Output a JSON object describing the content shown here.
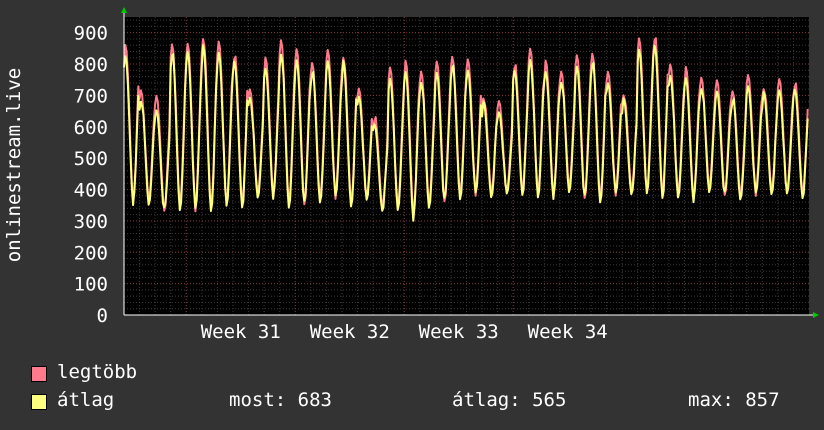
{
  "chart_data": {
    "type": "line",
    "ylabel": "onlinestream.live",
    "ylim": [
      0,
      950
    ],
    "y_ticks": [
      0,
      100,
      200,
      300,
      400,
      500,
      600,
      700,
      800,
      900
    ],
    "x_ticks": [
      "Week 31",
      "Week 32",
      "Week 33",
      "Week 34"
    ],
    "grid": true,
    "legend_placement": "bottom-left",
    "days": 44,
    "series": [
      {
        "name": "legtöbb",
        "color": "#ff7b8b",
        "daily_peaks": [
          850,
          720,
          690,
          870,
          860,
          890,
          870,
          830,
          720,
          810,
          880,
          840,
          810,
          840,
          830,
          720,
          630,
          790,
          800,
          780,
          800,
          830,
          810,
          700,
          680,
          800,
          850,
          800,
          780,
          820,
          840,
          770,
          710,
          880,
          890,
          800,
          780,
          760,
          740,
          720,
          760,
          730,
          750,
          740
        ],
        "daily_troughs": [
          370,
          360,
          340,
          350,
          340,
          345,
          350,
          360,
          380,
          390,
          350,
          360,
          370,
          380,
          360,
          370,
          350,
          340,
          330,
          350,
          370,
          380,
          390,
          390,
          390,
          400,
          380,
          390,
          400,
          380,
          370,
          390,
          400,
          390,
          390,
          380,
          380,
          400,
          390,
          380,
          390,
          400,
          390,
          390
        ]
      },
      {
        "name": "átlag",
        "color": "#ffff80",
        "daily_peaks": [
          820,
          690,
          650,
          840,
          840,
          850,
          840,
          800,
          700,
          780,
          840,
          810,
          780,
          810,
          800,
          700,
          600,
          760,
          770,
          750,
          770,
          800,
          780,
          670,
          650,
          770,
          820,
          770,
          750,
          790,
          810,
          740,
          680,
          850,
          850,
          770,
          750,
          730,
          710,
          690,
          730,
          700,
          720,
          710
        ],
        "daily_troughs": [
          360,
          350,
          330,
          335,
          330,
          335,
          340,
          350,
          370,
          380,
          340,
          350,
          360,
          370,
          350,
          360,
          340,
          330,
          310,
          340,
          360,
          370,
          380,
          380,
          380,
          390,
          370,
          380,
          390,
          370,
          360,
          380,
          390,
          380,
          380,
          370,
          370,
          390,
          380,
          370,
          380,
          390,
          380,
          380
        ]
      }
    ]
  },
  "legend": {
    "max_label": "legtöbb",
    "avg_label": "átlag",
    "stats": {
      "current": "most: 683",
      "average": "átlag: 565",
      "maximum": "max: 857"
    }
  }
}
